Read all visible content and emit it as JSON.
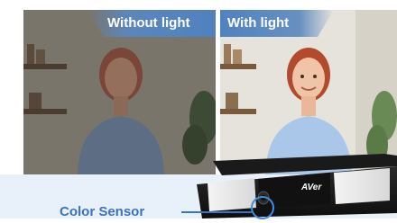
{
  "labels": {
    "without_light": "Without light",
    "with_light": "With light",
    "color_sensor": "Color Sensor"
  },
  "device": {
    "brand": "AVer"
  },
  "colors": {
    "accent_blue": "#3b73bf",
    "tab_blue": "#4f82bf",
    "band_bg": "#e8f1fa"
  }
}
